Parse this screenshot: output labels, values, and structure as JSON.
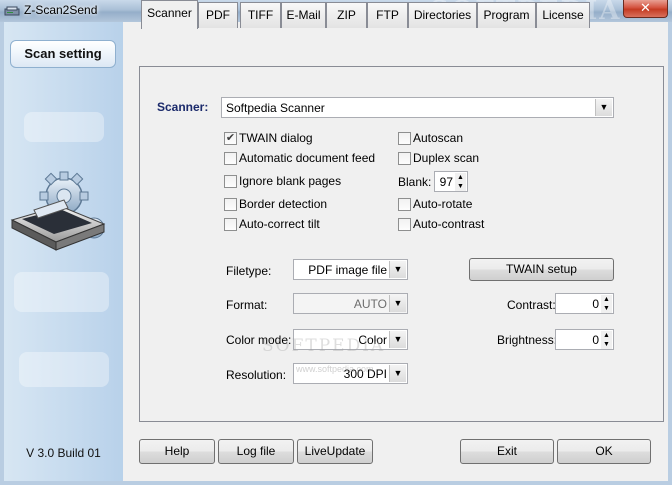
{
  "window": {
    "title": "Z-Scan2Send",
    "watermark": "SOFTPEDIA",
    "close_glyph": "✕",
    "icon": "scanner-app-icon"
  },
  "sidebar": {
    "nav_button": "Scan setting",
    "version": "V 3.0 Build 01",
    "illustration": "scanner-gears-icon"
  },
  "tabs": [
    {
      "label": "Scanner",
      "active": true
    },
    {
      "label": "PDF"
    },
    {
      "label": "TIFF"
    },
    {
      "label": "E-Mail"
    },
    {
      "label": "ZIP"
    },
    {
      "label": "FTP"
    },
    {
      "label": "Directories"
    },
    {
      "label": "Program"
    },
    {
      "label": "License"
    }
  ],
  "scanner": {
    "label": "Scanner:",
    "value": "Softpedia Scanner"
  },
  "options_left": [
    {
      "label": "TWAIN dialog",
      "checked": true
    },
    {
      "label": "Automatic document feed",
      "checked": false
    },
    {
      "label": "Ignore blank pages",
      "checked": false
    },
    {
      "label": "Border detection",
      "checked": false
    },
    {
      "label": "Auto-correct tilt",
      "checked": false
    }
  ],
  "options_right": [
    {
      "label": "Autoscan",
      "checked": false
    },
    {
      "label": "Duplex scan",
      "checked": false
    },
    {
      "label": "Auto-rotate",
      "checked": false
    },
    {
      "label": "Auto-contrast",
      "checked": false
    }
  ],
  "blank": {
    "label": "Blank:",
    "value": "97"
  },
  "filetype": {
    "label": "Filetype:",
    "value": "PDF image file"
  },
  "format": {
    "label": "Format:",
    "value": "AUTO"
  },
  "color_mode": {
    "label": "Color mode:",
    "value": "Color"
  },
  "resolution": {
    "label": "Resolution:",
    "value": "300 DPI"
  },
  "twain_setup": "TWAIN setup",
  "contrast": {
    "label": "Contrast:",
    "value": "0"
  },
  "brightness": {
    "label": "Brightness:",
    "value": "0"
  },
  "content_watermark": "SOFTPEDIA",
  "content_watermark_small": "www.softpedia.com",
  "footer": {
    "help": "Help",
    "log_file": "Log file",
    "live_update": "LiveUpdate",
    "exit": "Exit",
    "ok": "OK"
  }
}
